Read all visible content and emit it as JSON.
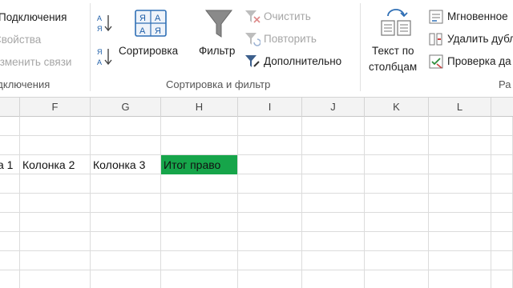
{
  "ribbon": {
    "connections": {
      "items": [
        "Подключения",
        "Свойства",
        "Изменить связи"
      ],
      "group_label": "Подключения"
    },
    "sort_filter": {
      "sort_az_label": "А↓Я",
      "sort_za_label": "Я↓А",
      "sort_label": "Сортировка",
      "filter_label": "Фильтр",
      "clear_label": "Очистить",
      "reapply_label": "Повторить",
      "advanced_label": "Дополнительно",
      "group_label": "Сортировка и фильтр"
    },
    "data_tools": {
      "text_to_columns_line1": "Текст по",
      "text_to_columns_line2": "столбцам",
      "flash_fill_label": "Мгновенное",
      "remove_duplicates_label": "Удалить дубл",
      "data_validation_label": "Проверка да",
      "group_label": "Ра"
    }
  },
  "sheet": {
    "columns": [
      "F",
      "G",
      "H",
      "I",
      "J",
      "K",
      "L"
    ],
    "cells": [
      "а 1",
      "Колонка 2",
      "Колонка 3",
      "Итог право"
    ],
    "highlight_color": "#16a54a"
  }
}
